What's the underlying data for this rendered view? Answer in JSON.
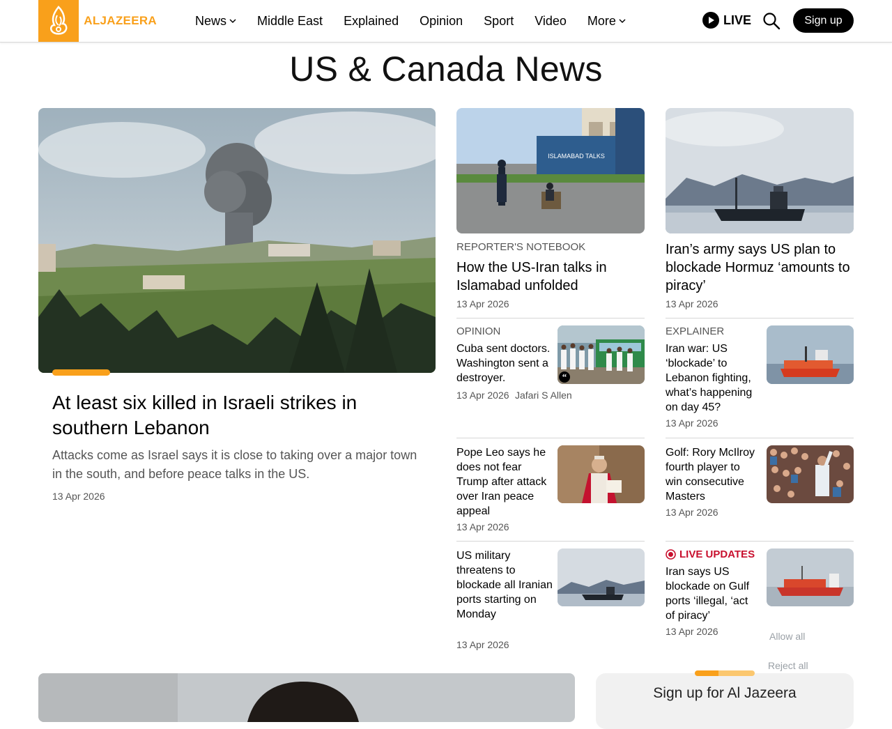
{
  "header": {
    "logo_text": "ALJAZEERA",
    "nav": [
      {
        "label": "News",
        "has_dropdown": true
      },
      {
        "label": "Middle East",
        "has_dropdown": false
      },
      {
        "label": "Explained",
        "has_dropdown": false
      },
      {
        "label": "Opinion",
        "has_dropdown": false
      },
      {
        "label": "Sport",
        "has_dropdown": false
      },
      {
        "label": "Video",
        "has_dropdown": false
      },
      {
        "label": "More",
        "has_dropdown": true
      }
    ],
    "live_label": "LIVE",
    "signup_label": "Sign up"
  },
  "page": {
    "title": "US & Canada News"
  },
  "hero": {
    "title": "At least six killed in Israeli strikes in southern Lebanon",
    "summary": "Attacks come as Israel says it is close to taking over a major town in the south, and before peace talks in the US.",
    "date": "13 Apr 2026"
  },
  "feature_cards": [
    {
      "kicker": "REPORTER'S NOTEBOOK",
      "title": "How the US-Iran talks in Islamabad unfolded",
      "date": "13 Apr 2026",
      "image_sign_text": "ISLAMABAD TALKS"
    },
    {
      "kicker": "",
      "title": "Iran’s army says US plan to blockade Hormuz ‘amounts to piracy’",
      "date": "13 Apr 2026"
    }
  ],
  "list_items": [
    {
      "kicker": "OPINION",
      "title": "Cuba sent doctors. Washington sent a destroyer.",
      "date": "13 Apr 2026",
      "author": "Jafari S Allen"
    },
    {
      "kicker": "EXPLAINER",
      "title": "Iran war: US ‘blockade’ to Lebanon fighting, what’s happening on day 45?",
      "date": "13 Apr 2026"
    },
    {
      "kicker": "",
      "title": "Pope Leo says he does not fear Trump after attack over Iran peace appeal",
      "date": "13 Apr 2026"
    },
    {
      "kicker": "",
      "title": "Golf: Rory McIlroy fourth player to win consecutive Masters",
      "date": "13 Apr 2026"
    },
    {
      "kicker": "",
      "title": "US military threatens to blockade all Iranian ports starting on Monday",
      "date": "13 Apr 2026"
    },
    {
      "kicker": "LIVE UPDATES",
      "title": "Iran says US blockade on Gulf ports ‘illegal, ‘act of piracy’",
      "date": "13 Apr 2026"
    }
  ],
  "cookie": {
    "allow_all": "Allow all",
    "reject_all": "Reject all"
  },
  "newsletter": {
    "title": "Sign up for Al Jazeera"
  },
  "colors": {
    "accent": "#f9a01b",
    "live_red": "#c8102e",
    "text_muted": "#555555"
  }
}
